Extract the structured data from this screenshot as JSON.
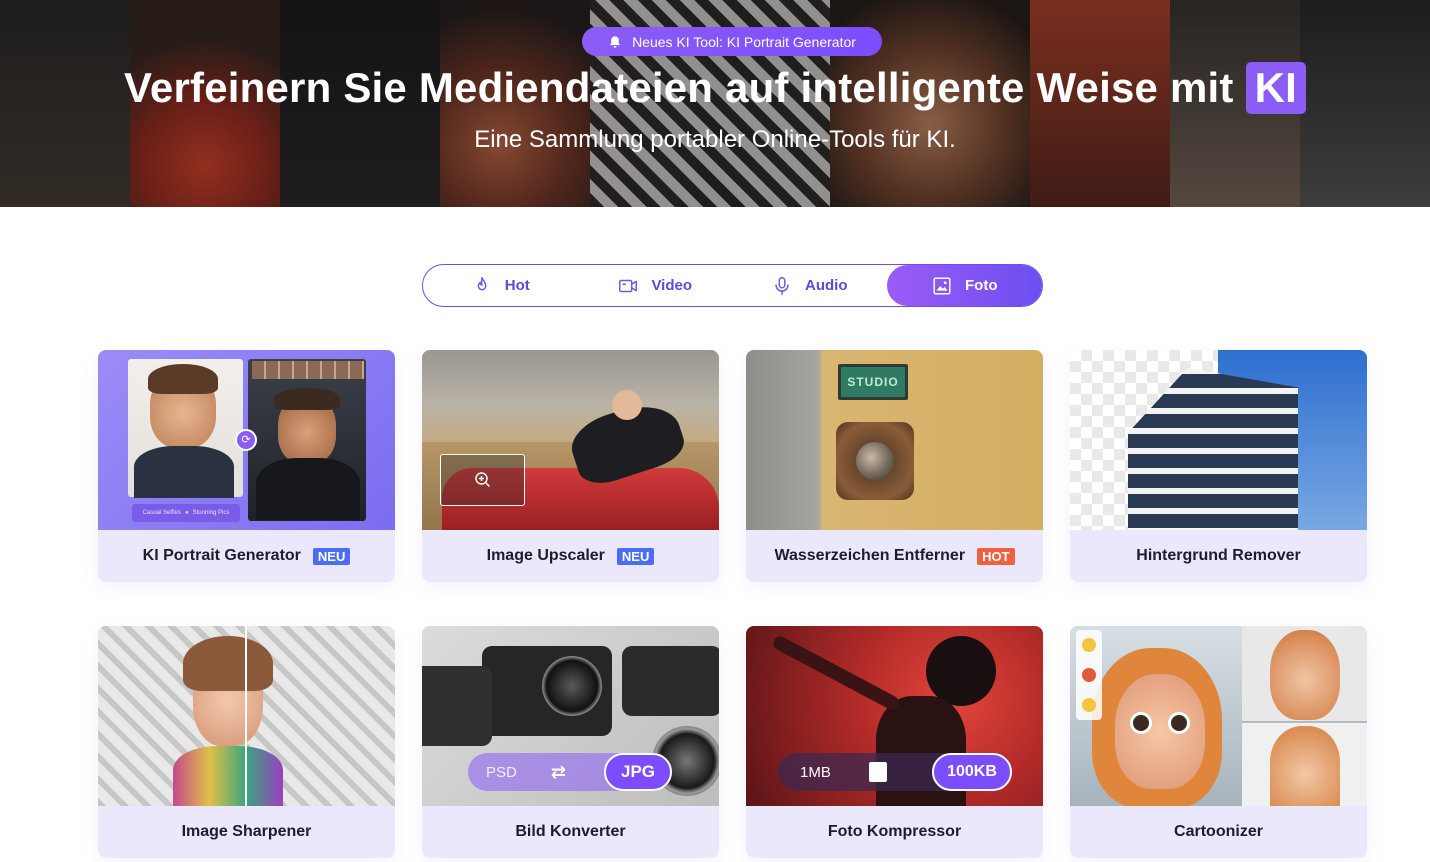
{
  "hero": {
    "announcement": "Neues KI Tool: KI Portrait Generator",
    "title": "Verfeinern Sie Mediendateien auf intelligente Weise mit",
    "title_badge": "KI",
    "subtitle": "Eine Sammlung portabler Online-Tools für KI."
  },
  "tabs": [
    {
      "label": "Hot",
      "icon": "flame-icon",
      "active": false
    },
    {
      "label": "Video",
      "icon": "video-icon",
      "active": false
    },
    {
      "label": "Audio",
      "icon": "microphone-icon",
      "active": false
    },
    {
      "label": "Foto",
      "icon": "image-icon",
      "active": true
    }
  ],
  "cards": [
    {
      "title": "KI Portrait Generator",
      "badge": "NEU",
      "badge_type": "neu",
      "overlay_left": "Casual Selfies",
      "overlay_right": "Stunning Pics"
    },
    {
      "title": "Image Upscaler",
      "badge": "NEU",
      "badge_type": "neu"
    },
    {
      "title": "Wasserzeichen Entferner",
      "badge": "HOT",
      "badge_type": "hot",
      "sign_text": "STUDIO"
    },
    {
      "title": "Hintergrund Remover",
      "badge": "",
      "badge_type": ""
    },
    {
      "title": "Image Sharpener",
      "badge": "",
      "badge_type": ""
    },
    {
      "title": "Bild Konverter",
      "badge": "",
      "badge_type": "",
      "from": "PSD",
      "to": "JPG"
    },
    {
      "title": "Foto Kompressor",
      "badge": "",
      "badge_type": "",
      "from": "1MB",
      "to": "100KB"
    },
    {
      "title": "Cartoonizer",
      "badge": "",
      "badge_type": ""
    }
  ],
  "colors": {
    "accent": "#6d4ef0",
    "card_bg": "#ece8fc",
    "neu": "#4b6df2",
    "hot": "#f0613f"
  }
}
